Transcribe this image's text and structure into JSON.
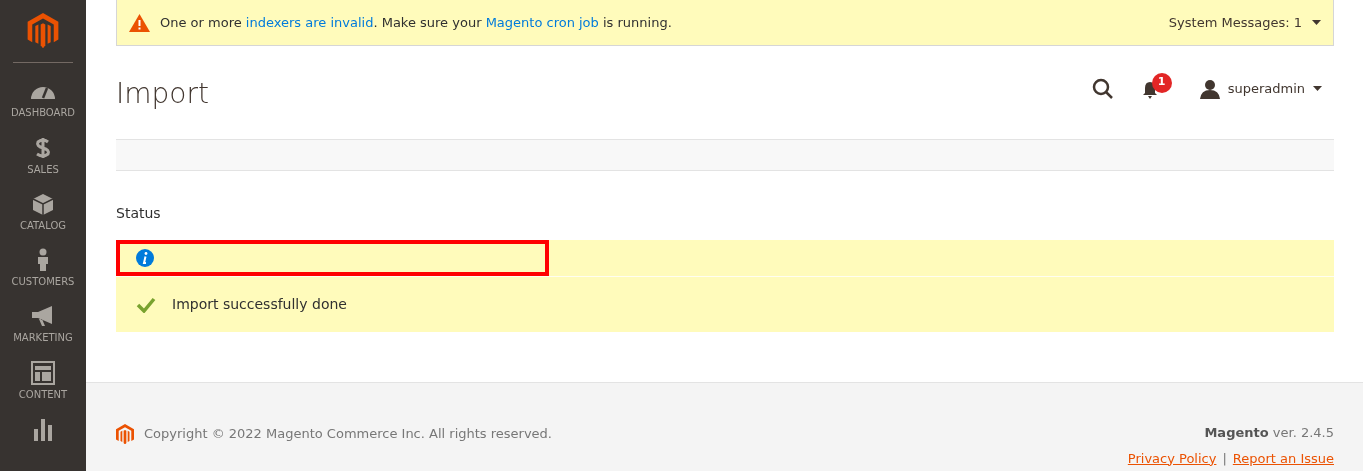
{
  "sidebar": {
    "items": [
      {
        "kind": "dashboard",
        "label": "DASHBOARD"
      },
      {
        "kind": "sales",
        "label": "SALES"
      },
      {
        "kind": "catalog",
        "label": "CATALOG"
      },
      {
        "kind": "customers",
        "label": "CUSTOMERS"
      },
      {
        "kind": "marketing",
        "label": "MARKETING"
      },
      {
        "kind": "content",
        "label": "CONTENT"
      },
      {
        "kind": "reports"
      }
    ]
  },
  "system_message": {
    "parts": [
      {
        "kind": "text",
        "text": "One or more "
      },
      {
        "kind": "link",
        "text": "indexers are invalid"
      },
      {
        "kind": "text",
        "text": ". Make sure your "
      },
      {
        "kind": "link",
        "text": "Magento cron job"
      },
      {
        "kind": "text",
        "text": " is running."
      }
    ],
    "counter": "System Messages: 1"
  },
  "header": {
    "title": "Import",
    "notifications": "1",
    "user": "superadmin"
  },
  "status": {
    "label": "Status",
    "messages": [
      {
        "kind": "info",
        "highlighted": true
      },
      {
        "kind": "success",
        "text": "Import successfully done",
        "highlighted": false
      }
    ]
  },
  "footer": {
    "copyright": "Copyright © 2022 Magento Commerce Inc. All rights reserved.",
    "version": "**Magento** ver. 2.4.5",
    "links": [
      "Privacy Policy",
      "Report an Issue"
    ],
    "separator": "|"
  }
}
